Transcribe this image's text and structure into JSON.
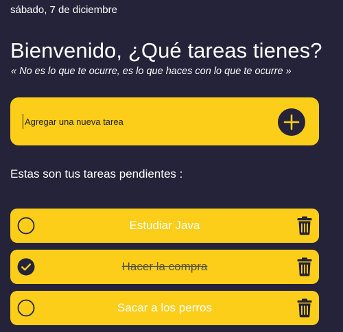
{
  "header": {
    "date": "sábado, 7 de diciembre",
    "title": "Bienvenido, ¿Qué tareas tienes?",
    "quote": "« No es lo que te ocurre, es lo que haces con lo que te ocurre »"
  },
  "add_task": {
    "placeholder": "Agregar una nueva tarea",
    "value": "",
    "button_icon": "plus-icon"
  },
  "list": {
    "heading": "Estas son tus tareas pendientes :",
    "tasks": [
      {
        "label": "Estudiar Java",
        "done": false
      },
      {
        "label": "Hacer la compra",
        "done": true
      },
      {
        "label": "Sacar a los perros",
        "done": false
      }
    ]
  },
  "colors": {
    "background": "#252339",
    "accent": "#fcce1a",
    "text": "#ffffff"
  }
}
